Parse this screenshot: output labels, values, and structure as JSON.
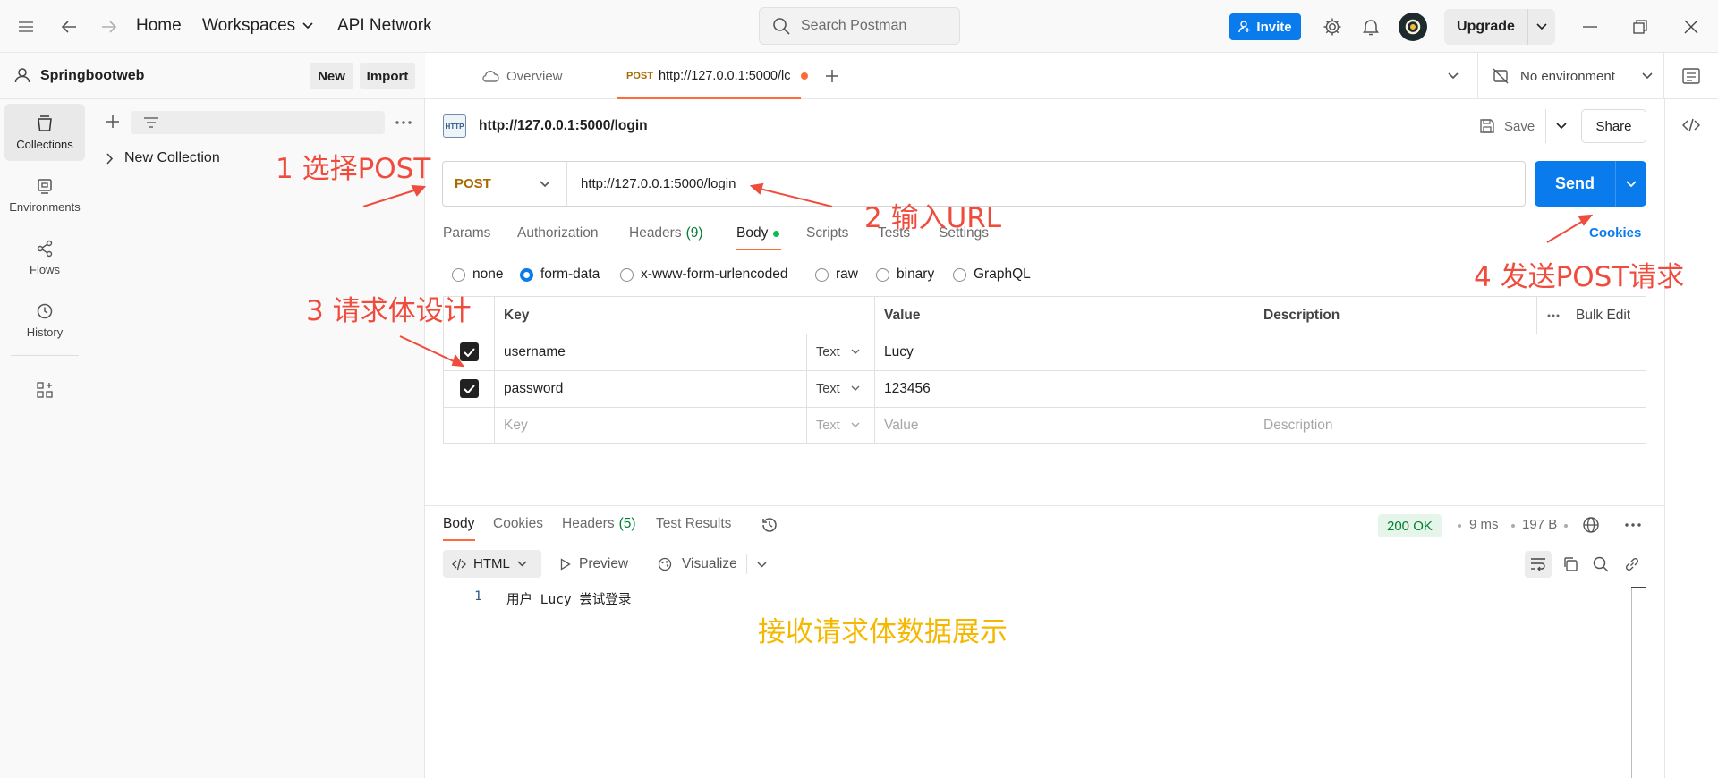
{
  "topbar": {
    "nav": [
      "Home",
      "Workspaces",
      "API Network"
    ],
    "search_placeholder": "Search Postman",
    "invite_label": "Invite",
    "upgrade_label": "Upgrade"
  },
  "rail": {
    "items": [
      {
        "label": "Collections",
        "icon": "collections-icon",
        "active": true
      },
      {
        "label": "Environments",
        "icon": "environments-icon",
        "active": false
      },
      {
        "label": "Flows",
        "icon": "flows-icon",
        "active": false
      },
      {
        "label": "History",
        "icon": "history-icon",
        "active": false
      }
    ]
  },
  "sidebar": {
    "workspace": "Springbootweb",
    "new_label": "New",
    "import_label": "Import",
    "collections": [
      "New Collection"
    ]
  },
  "tabs": {
    "overview": "Overview",
    "active_method": "POST",
    "active_title": "http://127.0.0.1:5000/lc",
    "environment": "No environment"
  },
  "request": {
    "breadcrumb": "http://127.0.0.1:5000/login",
    "http_badge": "HTTP",
    "save_label": "Save",
    "share_label": "Share",
    "method": "POST",
    "url": "http://127.0.0.1:5000/login",
    "send_label": "Send",
    "cookies_label": "Cookies",
    "subtabs": {
      "params": "Params",
      "authorization": "Authorization",
      "headers": "Headers",
      "headers_count": "(9)",
      "body": "Body",
      "scripts": "Scripts",
      "tests": "Tests",
      "settings": "Settings"
    },
    "body_types": [
      "none",
      "form-data",
      "x-www-form-urlencoded",
      "raw",
      "binary",
      "GraphQL"
    ],
    "body_selected": "form-data",
    "table": {
      "headers": {
        "key": "Key",
        "value": "Value",
        "description": "Description",
        "bulk_edit": "Bulk Edit"
      },
      "rows": [
        {
          "key": "username",
          "type": "Text",
          "value": "Lucy",
          "checked": true
        },
        {
          "key": "password",
          "type": "Text",
          "value": "123456",
          "checked": true
        }
      ],
      "placeholders": {
        "key": "Key",
        "type": "Text",
        "value": "Value",
        "description": "Description"
      }
    }
  },
  "response": {
    "tabs": {
      "body": "Body",
      "cookies": "Cookies",
      "headers": "Headers",
      "headers_count": "(5)",
      "test_results": "Test Results"
    },
    "status": "200 OK",
    "time": "9 ms",
    "size": "197 B",
    "format": "HTML",
    "preview_label": "Preview",
    "visualize_label": "Visualize",
    "lines": [
      {
        "n": "1",
        "text": "用户 Lucy 尝试登录"
      }
    ]
  },
  "annotations": {
    "a1": "1 选择POST",
    "a2": "2 输入URL",
    "a3": "3 请求体设计",
    "a4": "4 发送POST请求",
    "a5": "接收请求体数据展示"
  },
  "colors": {
    "brand_blue": "#097bed",
    "method_orange": "#a86a00",
    "active_tab_orange": "#ff6c37",
    "annotation_red": "#f04c3e",
    "annotation_yellow": "#f5b800",
    "status_green": "#007f31"
  }
}
